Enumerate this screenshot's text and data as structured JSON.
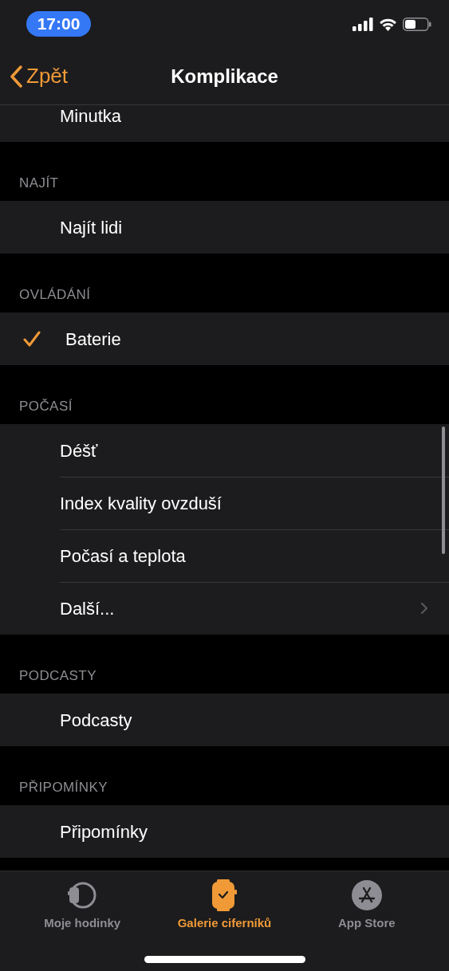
{
  "status_bar": {
    "time": "17:00"
  },
  "nav": {
    "back": "Zpět",
    "title": "Komplikace"
  },
  "sections": [
    {
      "rows": [
        {
          "label": "Minutka",
          "checked": false,
          "disclosure": false
        }
      ]
    },
    {
      "header": "NAJÍT",
      "rows": [
        {
          "label": "Najít lidi",
          "checked": false,
          "disclosure": false
        }
      ]
    },
    {
      "header": "OVLÁDÁNÍ",
      "rows": [
        {
          "label": "Baterie",
          "checked": true,
          "disclosure": false
        }
      ]
    },
    {
      "header": "POČASÍ",
      "rows": [
        {
          "label": "Déšť",
          "checked": false,
          "disclosure": false
        },
        {
          "label": "Index kvality ovzduší",
          "checked": false,
          "disclosure": false
        },
        {
          "label": "Počasí a teplota",
          "checked": false,
          "disclosure": false
        },
        {
          "label": "Další...",
          "checked": false,
          "disclosure": true
        }
      ]
    },
    {
      "header": "PODCASTY",
      "rows": [
        {
          "label": "Podcasty",
          "checked": false,
          "disclosure": false
        }
      ]
    },
    {
      "header": "PŘIPOMÍNKY",
      "rows": [
        {
          "label": "Připomínky",
          "checked": false,
          "disclosure": false
        }
      ]
    }
  ],
  "tabs": [
    {
      "label": "Moje hodinky",
      "selected": false
    },
    {
      "label": "Galerie ciferníků",
      "selected": true
    },
    {
      "label": "App Store",
      "selected": false
    }
  ]
}
